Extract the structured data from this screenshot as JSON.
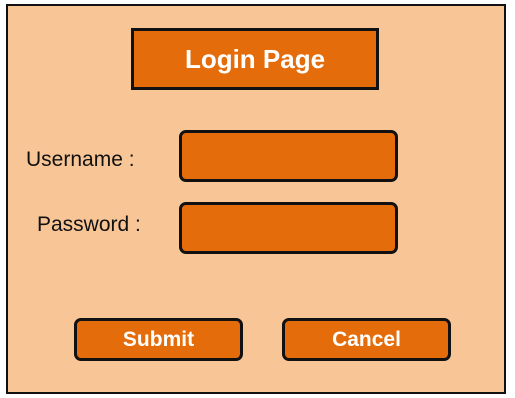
{
  "page": {
    "title": "Login Page"
  },
  "form": {
    "username_label": "Username :",
    "password_label": "Password :",
    "username_value": "",
    "password_value": ""
  },
  "actions": {
    "submit_label": "Submit",
    "cancel_label": "Cancel"
  },
  "colors": {
    "panel_background": "#f8c596",
    "accent": "#e46c0a",
    "border": "#111111",
    "button_text": "#ffffff"
  }
}
